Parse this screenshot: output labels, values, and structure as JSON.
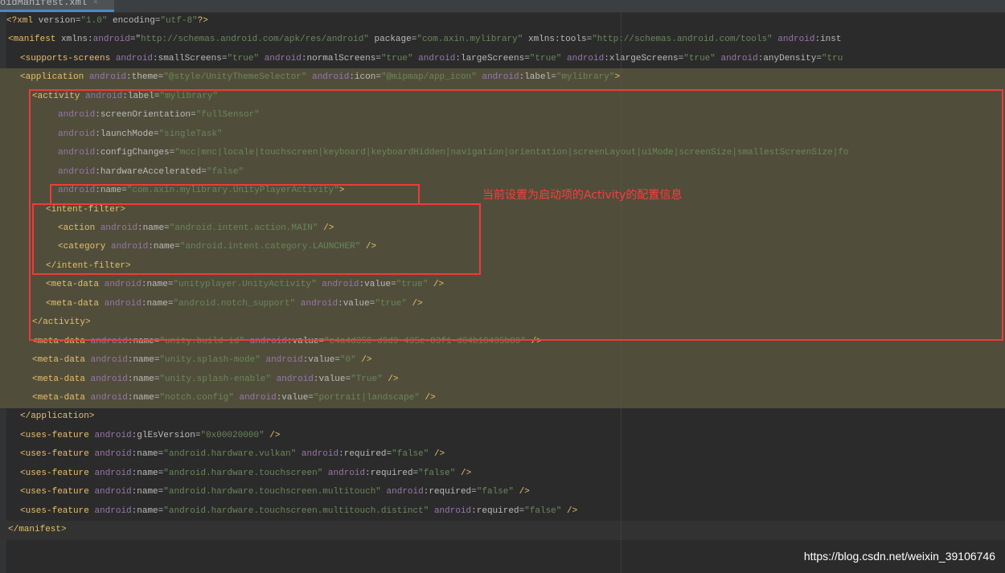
{
  "tab": {
    "label": "oidManifest.xml",
    "close": "×"
  },
  "colors": {
    "tag": "#e8bf6a",
    "namespace": "#9876aa",
    "value": "#6a8759",
    "highlight_box": "#f03a3a",
    "app_block_bg": "#504e3b"
  },
  "lines": [
    {
      "indent": 8,
      "tokens": [
        [
          "pi",
          "<?xml "
        ],
        [
          "attr",
          "version="
        ],
        [
          "val",
          "\"1.0\""
        ],
        [
          "attr",
          " encoding="
        ],
        [
          "val",
          "\"utf-8\""
        ],
        [
          "pi",
          "?>"
        ]
      ]
    },
    {
      "indent": 10,
      "tokens": [
        [
          "tag",
          "<manifest"
        ],
        [
          "attr",
          " xmlns:"
        ],
        [
          "ns",
          "android"
        ],
        [
          "attr",
          "=\""
        ],
        [
          "val",
          "http://schemas.android.com/apk/res/android\""
        ],
        [
          "attr",
          " package="
        ],
        [
          "val",
          "\"com.axin.mylibrary\""
        ],
        [
          "attr",
          " xmlns:tools="
        ],
        [
          "val",
          "\"http://schemas.android.com/tools\""
        ],
        [
          "attr",
          " "
        ],
        [
          "ns",
          "android"
        ],
        [
          "attr",
          ":inst"
        ]
      ]
    },
    {
      "indent": 25,
      "tokens": [
        [
          "tag",
          "<supports-screens"
        ],
        [
          "attr",
          " "
        ],
        [
          "ns",
          "android"
        ],
        [
          "attr",
          ":smallScreens="
        ],
        [
          "val",
          "\"true\""
        ],
        [
          "attr",
          " "
        ],
        [
          "ns",
          "android"
        ],
        [
          "attr",
          ":normalScreens="
        ],
        [
          "val",
          "\"true\""
        ],
        [
          "attr",
          " "
        ],
        [
          "ns",
          "android"
        ],
        [
          "attr",
          ":largeScreens="
        ],
        [
          "val",
          "\"true\""
        ],
        [
          "attr",
          " "
        ],
        [
          "ns",
          "android"
        ],
        [
          "attr",
          ":xlargeScreens="
        ],
        [
          "val",
          "\"true\""
        ],
        [
          "attr",
          " "
        ],
        [
          "ns",
          "android"
        ],
        [
          "attr",
          ":anyDensity="
        ],
        [
          "val",
          "\"tru"
        ]
      ]
    },
    {
      "indent": 25,
      "app": true,
      "tokens": [
        [
          "tag",
          "<application"
        ],
        [
          "attr",
          " "
        ],
        [
          "ns",
          "android"
        ],
        [
          "attr",
          ":theme="
        ],
        [
          "val",
          "\"@style/UnityThemeSelector\""
        ],
        [
          "attr",
          " "
        ],
        [
          "ns",
          "android"
        ],
        [
          "attr",
          ":icon="
        ],
        [
          "val",
          "\"@mipmap/app_icon\""
        ],
        [
          "attr",
          " "
        ],
        [
          "ns",
          "android"
        ],
        [
          "attr",
          ":label="
        ],
        [
          "val",
          "\"mylibrary\""
        ],
        [
          "tag",
          ">"
        ]
      ]
    },
    {
      "indent": 40,
      "app": true,
      "tokens": [
        [
          "tag",
          "<activity"
        ],
        [
          "attr",
          " "
        ],
        [
          "ns",
          "android"
        ],
        [
          "attr",
          ":label="
        ],
        [
          "val",
          "\"mylibrary\""
        ]
      ]
    },
    {
      "indent": 72,
      "app": true,
      "tokens": [
        [
          "ns",
          "android"
        ],
        [
          "attr",
          ":screenOrientation="
        ],
        [
          "val",
          "\"fullSensor\""
        ]
      ]
    },
    {
      "indent": 72,
      "app": true,
      "tokens": [
        [
          "ns",
          "android"
        ],
        [
          "attr",
          ":launchMode="
        ],
        [
          "val",
          "\"singleTask\""
        ]
      ]
    },
    {
      "indent": 72,
      "app": true,
      "tokens": [
        [
          "ns",
          "android"
        ],
        [
          "attr",
          ":configChanges="
        ],
        [
          "val",
          "\"mcc|mnc|locale|touchscreen|keyboard|keyboardHidden|navigation|orientation|screenLayout|uiMode|screenSize|smallestScreenSize|fo"
        ]
      ]
    },
    {
      "indent": 72,
      "app": true,
      "tokens": [
        [
          "ns",
          "android"
        ],
        [
          "attr",
          ":hardwareAccelerated="
        ],
        [
          "val",
          "\"false\""
        ]
      ]
    },
    {
      "indent": 72,
      "app": true,
      "tokens": [
        [
          "ns",
          "android"
        ],
        [
          "attr",
          ":name="
        ],
        [
          "val",
          "\"com.axin.mylibrary.UnityPlayerActivity\""
        ],
        [
          "tag",
          ">"
        ]
      ]
    },
    {
      "indent": 57,
      "app": true,
      "tokens": [
        [
          "tag",
          "<intent-filter>"
        ]
      ]
    },
    {
      "indent": 72,
      "app": true,
      "tokens": [
        [
          "tag",
          "<action"
        ],
        [
          "attr",
          " "
        ],
        [
          "ns",
          "android"
        ],
        [
          "attr",
          ":name="
        ],
        [
          "val",
          "\"android.intent.action.MAIN\""
        ],
        [
          "tag",
          " />"
        ]
      ]
    },
    {
      "indent": 72,
      "app": true,
      "tokens": [
        [
          "tag",
          "<category"
        ],
        [
          "attr",
          " "
        ],
        [
          "ns",
          "android"
        ],
        [
          "attr",
          ":name="
        ],
        [
          "val",
          "\"android.intent.category.LAUNCHER\""
        ],
        [
          "tag",
          " />"
        ]
      ]
    },
    {
      "indent": 57,
      "app": true,
      "tokens": [
        [
          "tag",
          "</intent-filter>"
        ]
      ]
    },
    {
      "indent": 57,
      "app": true,
      "tokens": [
        [
          "tag",
          "<meta-data"
        ],
        [
          "attr",
          " "
        ],
        [
          "ns",
          "android"
        ],
        [
          "attr",
          ":name="
        ],
        [
          "val",
          "\"unityplayer.UnityActivity\""
        ],
        [
          "attr",
          " "
        ],
        [
          "ns",
          "android"
        ],
        [
          "attr",
          ":value="
        ],
        [
          "val",
          "\"true\""
        ],
        [
          "tag",
          " />"
        ]
      ]
    },
    {
      "indent": 57,
      "app": true,
      "tokens": [
        [
          "tag",
          "<meta-data"
        ],
        [
          "attr",
          " "
        ],
        [
          "ns",
          "android"
        ],
        [
          "attr",
          ":name="
        ],
        [
          "val",
          "\"android.notch_support\""
        ],
        [
          "attr",
          " "
        ],
        [
          "ns",
          "android"
        ],
        [
          "attr",
          ":value="
        ],
        [
          "val",
          "\"true\""
        ],
        [
          "tag",
          " />"
        ]
      ]
    },
    {
      "indent": 40,
      "app": true,
      "tokens": [
        [
          "tag",
          "</activity>"
        ]
      ]
    },
    {
      "indent": 40,
      "app": true,
      "tokens": [
        [
          "tag",
          "<meta-data"
        ],
        [
          "attr",
          " "
        ],
        [
          "ns",
          "android"
        ],
        [
          "attr",
          ":name="
        ],
        [
          "val",
          "\"unity.build-id\""
        ],
        [
          "attr",
          " "
        ],
        [
          "ns",
          "android"
        ],
        [
          "attr",
          ":value="
        ],
        [
          "val",
          "\"c4a4d356-d9d9-435e-83f1-d04b18435b80\""
        ],
        [
          "tag",
          " />"
        ]
      ]
    },
    {
      "indent": 40,
      "app": true,
      "tokens": [
        [
          "tag",
          "<meta-data"
        ],
        [
          "attr",
          " "
        ],
        [
          "ns",
          "android"
        ],
        [
          "attr",
          ":name="
        ],
        [
          "val",
          "\"unity.splash-mode\""
        ],
        [
          "attr",
          " "
        ],
        [
          "ns",
          "android"
        ],
        [
          "attr",
          ":value="
        ],
        [
          "val",
          "\"0\""
        ],
        [
          "tag",
          " />"
        ]
      ]
    },
    {
      "indent": 40,
      "app": true,
      "tokens": [
        [
          "tag",
          "<meta-data"
        ],
        [
          "attr",
          " "
        ],
        [
          "ns",
          "android"
        ],
        [
          "attr",
          ":name="
        ],
        [
          "val",
          "\"unity.splash-enable\""
        ],
        [
          "attr",
          " "
        ],
        [
          "ns",
          "android"
        ],
        [
          "attr",
          ":value="
        ],
        [
          "val",
          "\"True\""
        ],
        [
          "tag",
          " />"
        ]
      ]
    },
    {
      "indent": 40,
      "app": true,
      "tokens": [
        [
          "tag",
          "<meta-data"
        ],
        [
          "attr",
          " "
        ],
        [
          "ns",
          "android"
        ],
        [
          "attr",
          ":name="
        ],
        [
          "val",
          "\"notch.config\""
        ],
        [
          "attr",
          " "
        ],
        [
          "ns",
          "android"
        ],
        [
          "attr",
          ":value="
        ],
        [
          "val",
          "\"portrait|landscape\""
        ],
        [
          "tag",
          " />"
        ]
      ]
    },
    {
      "indent": 25,
      "tokens": [
        [
          "tag",
          "</application>"
        ]
      ]
    },
    {
      "indent": 25,
      "tokens": [
        [
          "tag",
          "<uses-feature"
        ],
        [
          "attr",
          " "
        ],
        [
          "ns",
          "android"
        ],
        [
          "attr",
          ":glEsVersion="
        ],
        [
          "val",
          "\"0x00020000\""
        ],
        [
          "tag",
          " />"
        ]
      ]
    },
    {
      "indent": 25,
      "tokens": [
        [
          "tag",
          "<uses-feature"
        ],
        [
          "attr",
          " "
        ],
        [
          "ns",
          "android"
        ],
        [
          "attr",
          ":name="
        ],
        [
          "val",
          "\"android.hardware.vulkan\""
        ],
        [
          "attr",
          " "
        ],
        [
          "ns",
          "android"
        ],
        [
          "attr",
          ":required="
        ],
        [
          "val",
          "\"false\""
        ],
        [
          "tag",
          " />"
        ]
      ]
    },
    {
      "indent": 25,
      "tokens": [
        [
          "tag",
          "<uses-feature"
        ],
        [
          "attr",
          " "
        ],
        [
          "ns",
          "android"
        ],
        [
          "attr",
          ":name="
        ],
        [
          "val",
          "\"android.hardware.touchscreen\""
        ],
        [
          "attr",
          " "
        ],
        [
          "ns",
          "android"
        ],
        [
          "attr",
          ":required="
        ],
        [
          "val",
          "\"false\""
        ],
        [
          "tag",
          " />"
        ]
      ]
    },
    {
      "indent": 25,
      "tokens": [
        [
          "tag",
          "<uses-feature"
        ],
        [
          "attr",
          " "
        ],
        [
          "ns",
          "android"
        ],
        [
          "attr",
          ":name="
        ],
        [
          "val",
          "\"android.hardware.touchscreen.multitouch\""
        ],
        [
          "attr",
          " "
        ],
        [
          "ns",
          "android"
        ],
        [
          "attr",
          ":required="
        ],
        [
          "val",
          "\"false\""
        ],
        [
          "tag",
          " />"
        ]
      ]
    },
    {
      "indent": 25,
      "tokens": [
        [
          "tag",
          "<uses-feature"
        ],
        [
          "attr",
          " "
        ],
        [
          "ns",
          "android"
        ],
        [
          "attr",
          ":name="
        ],
        [
          "val",
          "\"android.hardware.touchscreen.multitouch.distinct\""
        ],
        [
          "attr",
          " "
        ],
        [
          "ns",
          "android"
        ],
        [
          "attr",
          ":required="
        ],
        [
          "val",
          "\"false\""
        ],
        [
          "tag",
          " />"
        ]
      ]
    },
    {
      "indent": 10,
      "cur": true,
      "tokens": [
        [
          "tag",
          "</manifest>"
        ]
      ]
    }
  ],
  "annotation": "当前设置为启动项的Activity的配置信息",
  "watermark": "https://blog.csdn.net/weixin_39106746"
}
